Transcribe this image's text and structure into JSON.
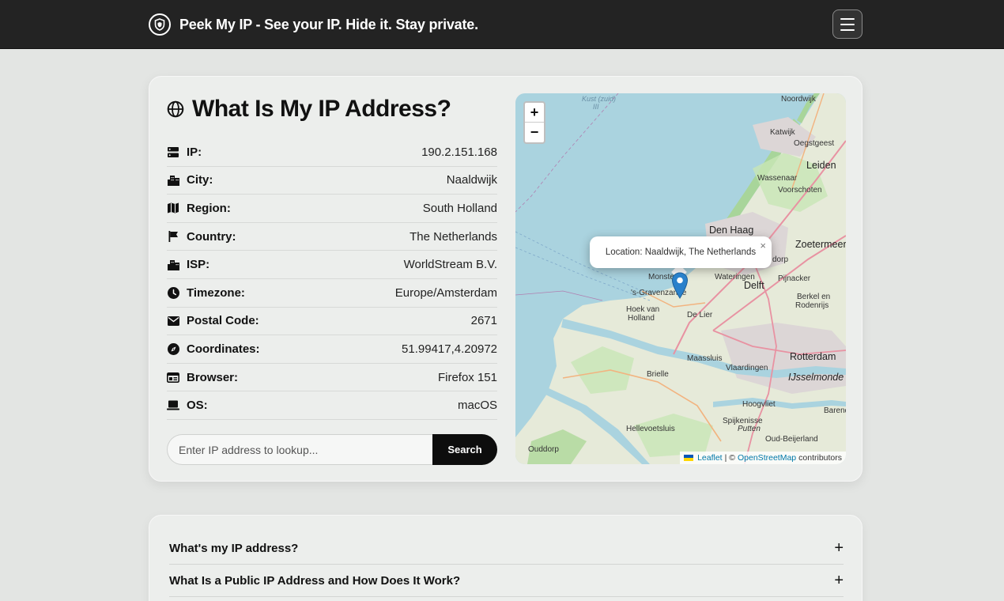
{
  "header": {
    "title": "Peek My IP - See your IP. Hide it. Stay private.",
    "brand_icon": "shield-icon",
    "menu_icon": "hamburger-menu-icon"
  },
  "card": {
    "title": "What Is My IP Address?",
    "title_icon": "globe-icon",
    "rows": [
      {
        "icon": "server-icon",
        "label": "IP:",
        "value": "190.2.151.168"
      },
      {
        "icon": "city-icon",
        "label": "City:",
        "value": "Naaldwijk"
      },
      {
        "icon": "map-icon",
        "label": "Region:",
        "value": "South Holland"
      },
      {
        "icon": "flag-icon",
        "label": "Country:",
        "value": "The Netherlands"
      },
      {
        "icon": "building-icon",
        "label": "ISP:",
        "value": "WorldStream B.V."
      },
      {
        "icon": "clock-icon",
        "label": "Timezone:",
        "value": "Europe/Amsterdam"
      },
      {
        "icon": "envelope-icon",
        "label": "Postal Code:",
        "value": "2671"
      },
      {
        "icon": "compass-icon",
        "label": "Coordinates:",
        "value": "51.99417,4.20972"
      },
      {
        "icon": "browser-icon",
        "label": "Browser:",
        "value": "Firefox 151"
      },
      {
        "icon": "laptop-icon",
        "label": "OS:",
        "value": "macOS"
      }
    ],
    "lookup": {
      "placeholder": "Enter IP address to lookup...",
      "button": "Search"
    }
  },
  "map": {
    "zoom_in": "+",
    "zoom_out": "−",
    "popup": "Location: Naaldwijk, The Netherlands",
    "popup_close": "×",
    "attribution": {
      "leaflet": "Leaflet",
      "separator": "| ©",
      "osm": "OpenStreetMap",
      "suffix": "contributors"
    },
    "labels": {
      "noordwijk": "Noordwijk",
      "katwijk": "Katwijk",
      "oegstgeest": "Oegstgeest",
      "leiden": "Leiden",
      "wassenaar": "Wassenaar",
      "voorschoten": "Voorschoten",
      "den_haag": "Den Haag",
      "zoetermeer": "Zoetermeer",
      "dorp": "dorp",
      "monster": "Monster",
      "wateringen": "Wateringen",
      "pijnacker": "Pijnacker",
      "delft": "Delft",
      "gravenzande": "'s-Gravenzande",
      "berkel": "Berkel en",
      "rodenrijs": "Rodenrijs",
      "hoek": "Hoek van",
      "holland": "Holland",
      "de_lier": "De Lier",
      "maassluis": "Maassluis",
      "rotterdam": "Rotterdam",
      "vlaardingen": "Vlaardingen",
      "brielle": "Brielle",
      "ijsselmonde": "IJsselmonde",
      "hoogvliet": "Hoogvliet",
      "barend": "Barend",
      "hellevoetsluis": "Hellevoetsluis",
      "spijkenisse": "Spijkenisse",
      "putten": "Putten",
      "oud_beijerland": "Oud-Beijerland",
      "ouddorp": "Ouddorp",
      "kust": "Kust (zuid)",
      "kust_num": "III"
    }
  },
  "faq": [
    {
      "q": "What's my IP address?",
      "icon": "plus-icon"
    },
    {
      "q": "What Is a Public IP Address and How Does It Work?",
      "icon": "plus-icon"
    }
  ]
}
